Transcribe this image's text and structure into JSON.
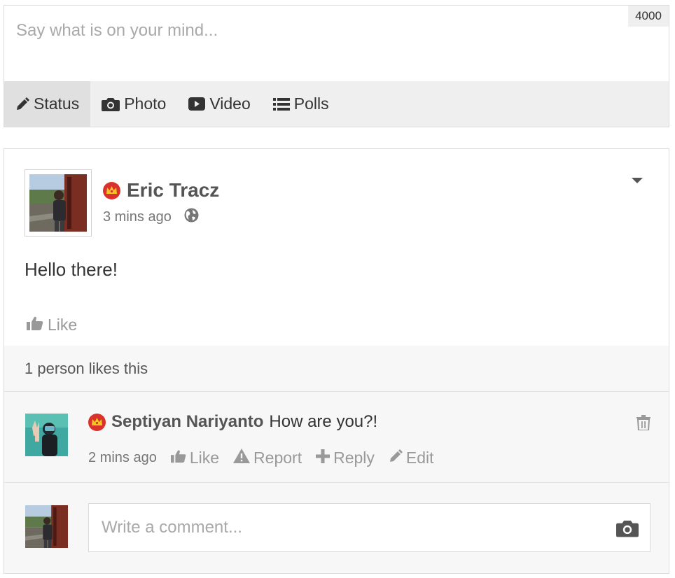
{
  "composer": {
    "placeholder": "Say what is on your mind...",
    "char_limit": "4000",
    "tabs": [
      {
        "label": "Status",
        "icon": "pencil-icon",
        "active": true
      },
      {
        "label": "Photo",
        "icon": "camera-icon",
        "active": false
      },
      {
        "label": "Video",
        "icon": "video-icon",
        "active": false
      },
      {
        "label": "Polls",
        "icon": "list-icon",
        "active": false
      }
    ]
  },
  "post": {
    "author": "Eric Tracz",
    "author_badge": "crown-badge-icon",
    "time": "3 mins ago",
    "privacy_icon": "globe-icon",
    "body": "Hello there!",
    "like_label": "Like",
    "likes_summary": "1 person likes this"
  },
  "comment": {
    "author": "Septiyan Nariyanto",
    "text": "How are you?!",
    "time": "2 mins ago",
    "actions": {
      "like": "Like",
      "report": "Report",
      "reply": "Reply",
      "edit": "Edit"
    }
  },
  "reply": {
    "placeholder": "Write a comment..."
  },
  "colors": {
    "badge_red": "#d9322b",
    "badge_gold": "#f5c325",
    "name_gray": "#555555",
    "muted": "#999999",
    "tab_bar": "#efefef"
  }
}
